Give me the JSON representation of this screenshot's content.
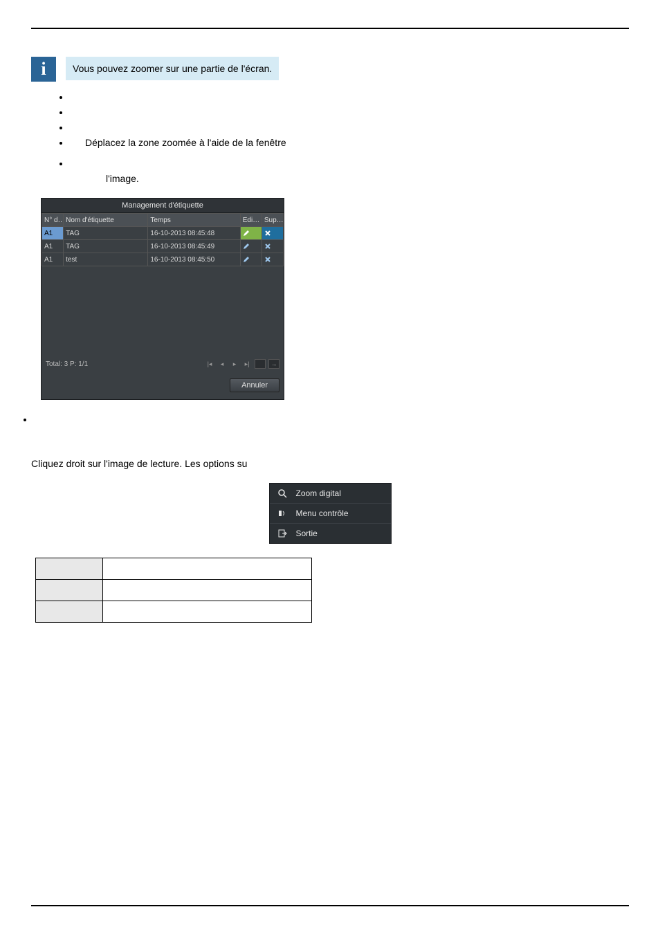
{
  "info_note": "Vous pouvez zoomer sur une partie de l'écran.",
  "bullets": {
    "b4": "Déplacez la zone zoomée à l'aide de la fenêtre",
    "b5_tail": "l'image."
  },
  "mgmt": {
    "title": "Management d'étiquette",
    "headers": {
      "cam": "N° d…",
      "name": "Nom d'étiquette",
      "time": "Temps",
      "edit": "Edi…",
      "del": "Sup…"
    },
    "rows": [
      {
        "cam": "A1",
        "name": "TAG",
        "time": "16-10-2013 08:45:48"
      },
      {
        "cam": "A1",
        "name": "TAG",
        "time": "16-10-2013 08:45:49"
      },
      {
        "cam": "A1",
        "name": "test",
        "time": "16-10-2013 08:45:50"
      }
    ],
    "total": "Total: 3 P: 1/1",
    "cancel": "Annuler"
  },
  "section_text": "Cliquez droit sur l'image de lecture. Les options su",
  "ctx": {
    "items": [
      {
        "label": "Zoom digital"
      },
      {
        "label": "Menu contrôle"
      },
      {
        "label": "Sortie"
      }
    ]
  },
  "desc_table": {
    "rows": [
      {
        "k": "",
        "v": ""
      },
      {
        "k": "",
        "v": ""
      },
      {
        "k": "",
        "v": ""
      }
    ]
  }
}
